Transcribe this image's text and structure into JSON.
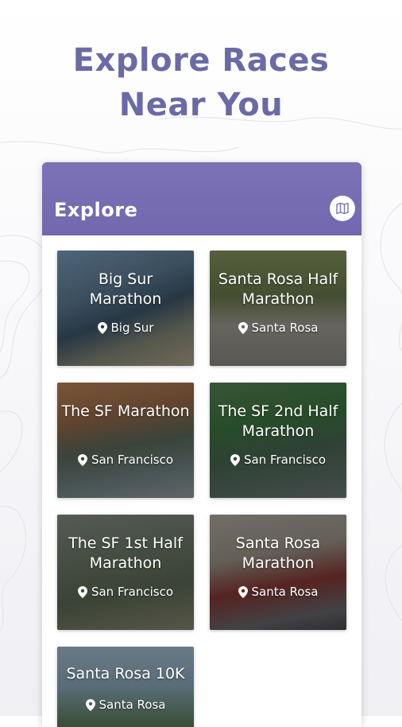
{
  "headline": {
    "line1": "Explore Races",
    "line2": "Near You"
  },
  "appbar": {
    "title": "Explore",
    "map_icon": "map-icon"
  },
  "races": [
    {
      "name": "Big Sur Marathon",
      "location": "Big Sur"
    },
    {
      "name": "Santa Rosa Half Marathon",
      "location": "Santa Rosa"
    },
    {
      "name": "The SF Marathon",
      "location": "San Francisco"
    },
    {
      "name": "The SF 2nd Half Marathon",
      "location": "San Francisco"
    },
    {
      "name": "The SF 1st Half Marathon",
      "location": "San Francisco"
    },
    {
      "name": "Santa Rosa Marathon",
      "location": "Santa Rosa"
    },
    {
      "name": "Santa Rosa 10K",
      "location": "Santa Rosa"
    }
  ],
  "colors": {
    "accent": "#6a6aa6",
    "appbar": "#7469b0"
  }
}
